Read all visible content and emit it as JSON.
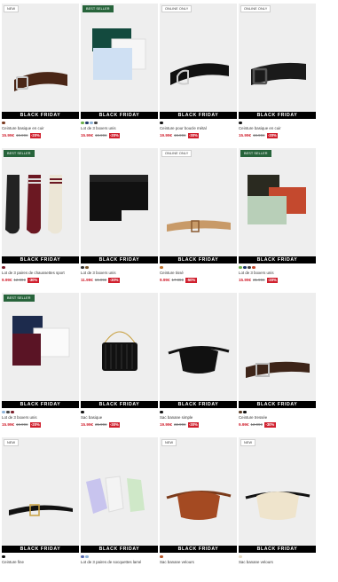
{
  "promo_label": "BLACK FRIDAY",
  "products": [
    {
      "badge": "NEW",
      "badge_style": "light",
      "name": "Ceinture basique en cuir",
      "price": "15.99€",
      "old_price": "19.99€",
      "discount": "-20%",
      "swatches": [
        "#7a3b20"
      ],
      "art": "belt-brown-icon"
    },
    {
      "badge": "BEST SELLER",
      "badge_style": "green",
      "name": "Lot de 3 boxers unis",
      "price": "15.99€",
      "old_price": "19.99€",
      "discount": "-20%",
      "swatches": [
        "#6bb04a",
        "#1f3a6b",
        "#8fb4d9",
        "#444"
      ],
      "art": "boxers-stack-icon"
    },
    {
      "badge": "ONLINE ONLY",
      "badge_style": "light",
      "name": "Ceinture pour boucle métal",
      "price": "19.99€",
      "old_price": "19.99€",
      "discount": "-30%",
      "swatches": [
        "#111"
      ],
      "art": "belt-black-icon"
    },
    {
      "badge": "ONLINE ONLY",
      "badge_style": "light",
      "name": "Ceinture basique en cuir",
      "price": "15.99€",
      "old_price": "19.99€",
      "discount": "-20%",
      "swatches": [
        "#111"
      ],
      "art": "belt-black-square-icon"
    },
    {
      "badge": "BEST SELLER",
      "badge_style": "green",
      "name": "Lot de 3 paires de chaussettes sport",
      "price": "9.99€",
      "old_price": "12.99€",
      "discount": "-30%",
      "swatches": [
        "#7a1e2a"
      ],
      "art": "socks-icon"
    },
    {
      "badge": "",
      "badge_style": "none",
      "name": "Lot de 3 boxers unis",
      "price": "11.99€",
      "old_price": "16.99€",
      "discount": "-30%",
      "swatches": [
        "#333",
        "#7a5a30"
      ],
      "art": "black-boxers-icon"
    },
    {
      "badge": "ONLINE ONLY",
      "badge_style": "light",
      "name": "Ceinture tissé",
      "price": "9.99€",
      "old_price": "17.99€",
      "discount": "-50%",
      "swatches": [
        "#c2742f"
      ],
      "art": "belt-woven-icon"
    },
    {
      "badge": "BEST SELLER",
      "badge_style": "green",
      "name": "Lot de 3 boxers unis",
      "price": "15.99€",
      "old_price": "21.99€",
      "discount": "-20%",
      "swatches": [
        "#6bb04a",
        "#1f3a6b",
        "#444",
        "#c4492e"
      ],
      "art": "boxers-colored-icon"
    },
    {
      "badge": "BEST SELLER",
      "badge_style": "green",
      "name": "Lot de 3 boxers unis",
      "price": "15.99€",
      "old_price": "19.99€",
      "discount": "-20%",
      "swatches": [
        "#8fb4d9",
        "#444",
        "#7a1e2a"
      ],
      "art": "boxers-navy-icon"
    },
    {
      "badge": "",
      "badge_style": "none",
      "name": "Sac basique",
      "price": "15.99€",
      "old_price": "25.99€",
      "discount": "-30%",
      "swatches": [
        "#111"
      ],
      "art": "bag-quilted-icon"
    },
    {
      "badge": "",
      "badge_style": "none",
      "name": "Sac banane simple",
      "price": "19.99€",
      "old_price": "22.99€",
      "discount": "-30%",
      "swatches": [
        "#111"
      ],
      "art": "belt-bag-black-icon"
    },
    {
      "badge": "",
      "badge_style": "none",
      "name": "Ceinture tressée",
      "price": "9.99€",
      "old_price": "12.99€",
      "discount": "-30%",
      "swatches": [
        "#5a3a22",
        "#111"
      ],
      "art": "belt-dark-brown-icon"
    },
    {
      "badge": "NEW",
      "badge_style": "light",
      "name": "Ceinture fine",
      "price": "",
      "old_price": "",
      "discount": "",
      "swatches": [
        "#111"
      ],
      "art": "belt-thin-icon"
    },
    {
      "badge": "",
      "badge_style": "none",
      "name": "Lot de 3 paires de socquettes lamé",
      "price": "",
      "old_price": "",
      "discount": "",
      "swatches": [
        "#5a6ab0",
        "#8fb4d9"
      ],
      "art": "ankle-socks-icon"
    },
    {
      "badge": "NEW",
      "badge_style": "light",
      "name": "Sac banane velours",
      "price": "",
      "old_price": "",
      "discount": "",
      "swatches": [
        "#b8562a"
      ],
      "art": "belt-bag-rust-icon"
    },
    {
      "badge": "NEW",
      "badge_style": "light",
      "name": "Sac banane velours",
      "price": "",
      "old_price": "",
      "discount": "",
      "swatches": [
        "#e8dcc4"
      ],
      "art": "belt-bag-cream-icon"
    }
  ]
}
